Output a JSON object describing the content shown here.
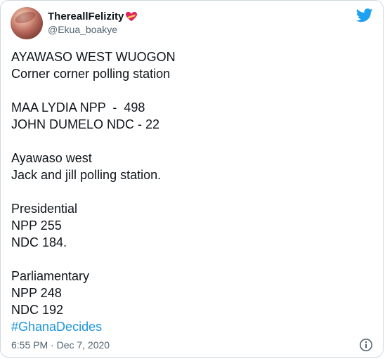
{
  "user": {
    "display_name": "ThereallFelizity",
    "handle": "@Ekua_boakye"
  },
  "tweet": {
    "lines": [
      "AYAWASO WEST WUOGON",
      "Corner corner polling station",
      "",
      "MAA LYDIA NPP  -  498",
      "JOHN DUMELO NDC - 22",
      "",
      "Ayawaso west",
      "Jack and jill polling station.",
      "",
      "Presidential",
      "NPP 255",
      "NDC 184.",
      "",
      "Parliamentary",
      "NPP 248",
      "NDC 192"
    ],
    "hashtag": "#GhanaDecides"
  },
  "meta": {
    "timestamp": "6:55 PM · Dec 7, 2020"
  },
  "icons": {
    "brand": "twitter-bird",
    "emoji": "heart-with-ribbon",
    "info": "info-circle"
  },
  "colors": {
    "brand": "#1da1f2",
    "hashtag": "#1b95e0",
    "secondary_text": "#536471"
  }
}
